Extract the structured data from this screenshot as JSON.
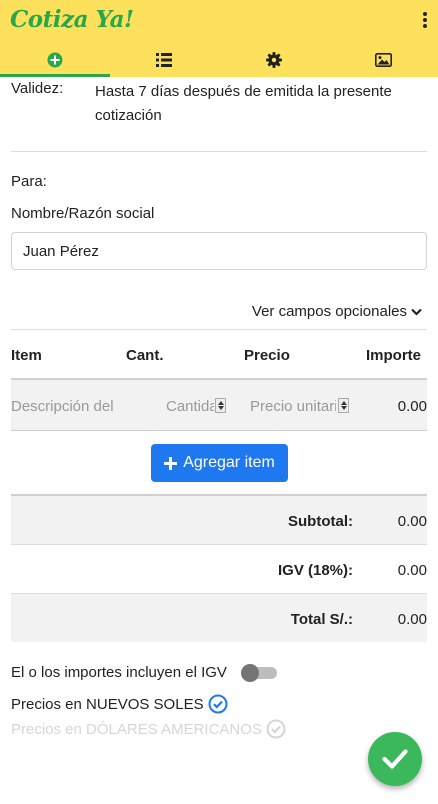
{
  "app": {
    "logo_text": "Cotiza Ya!"
  },
  "tabs": [
    {
      "icon": "plus-circle-icon",
      "active": true
    },
    {
      "icon": "list-icon",
      "active": false
    },
    {
      "icon": "gear-icon",
      "active": false
    },
    {
      "icon": "image-icon",
      "active": false
    }
  ],
  "validity": {
    "label": "Validez:",
    "text": "Hasta 7 días después de emitida la presente cotización"
  },
  "client": {
    "para_label": "Para:",
    "name_label": "Nombre/Razón social",
    "name_value": "Juan Pérez"
  },
  "optional_fields_link": "Ver campos opcionales",
  "items_table": {
    "headers": {
      "item": "Item",
      "qty": "Cant.",
      "price": "Precio",
      "amount": "Importe"
    },
    "row": {
      "description_placeholder": "Descripción del item",
      "qty_placeholder": "Cantidad",
      "price_placeholder": "Precio unitario",
      "amount": "0.00"
    }
  },
  "add_item_button": "Agregar item",
  "totals": {
    "subtotal_label": "Subtotal:",
    "subtotal_value": "0.00",
    "igv_label": "IGV (18%):",
    "igv_value": "0.00",
    "total_label": "Total S/.:",
    "total_value": "0.00"
  },
  "options": {
    "igv_included_label": "El o los importes incluyen el IGV",
    "igv_included": false,
    "currency_soles_label": "Precios en NUEVOS SOLES",
    "currency_dollars_label": "Precios en DÓLARES AMERICANOS",
    "selected_currency": "soles"
  },
  "colors": {
    "header_bg": "#fde15d",
    "accent_green": "#2aa64b",
    "button_blue": "#1e78f0",
    "fab_green": "#3bb85c"
  }
}
